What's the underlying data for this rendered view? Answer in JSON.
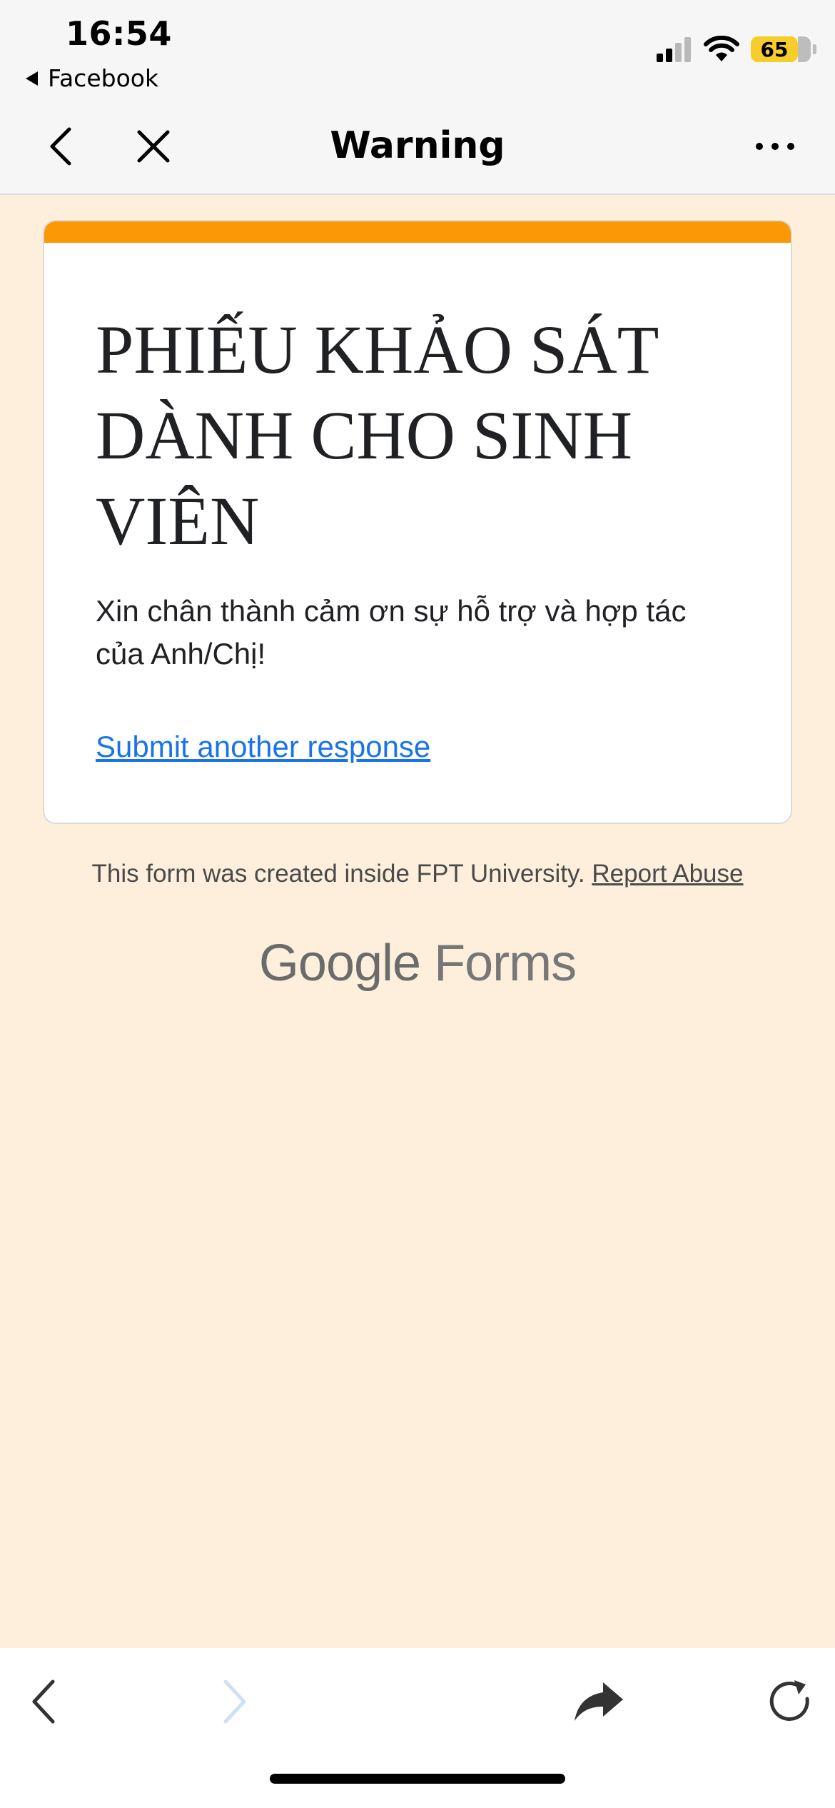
{
  "status_bar": {
    "time": "16:54",
    "back_app": "Facebook",
    "battery": "65"
  },
  "nav": {
    "title": "Warning"
  },
  "form": {
    "title": "PHIẾU KHẢO SÁT DÀNH CHO SINH VIÊN",
    "message": "Xin chân thành cảm ơn sự hỗ trợ và hợp tác của Anh/Chị!",
    "submit_link": "Submit another response",
    "accent_color": "#fb9806"
  },
  "footer": {
    "note": "This form was created inside FPT University.",
    "report_link": "Report Abuse",
    "brand_google": "Google",
    "brand_forms": "Forms"
  },
  "colors": {
    "page_background": "#fdefdb",
    "link": "#1a73e8"
  }
}
